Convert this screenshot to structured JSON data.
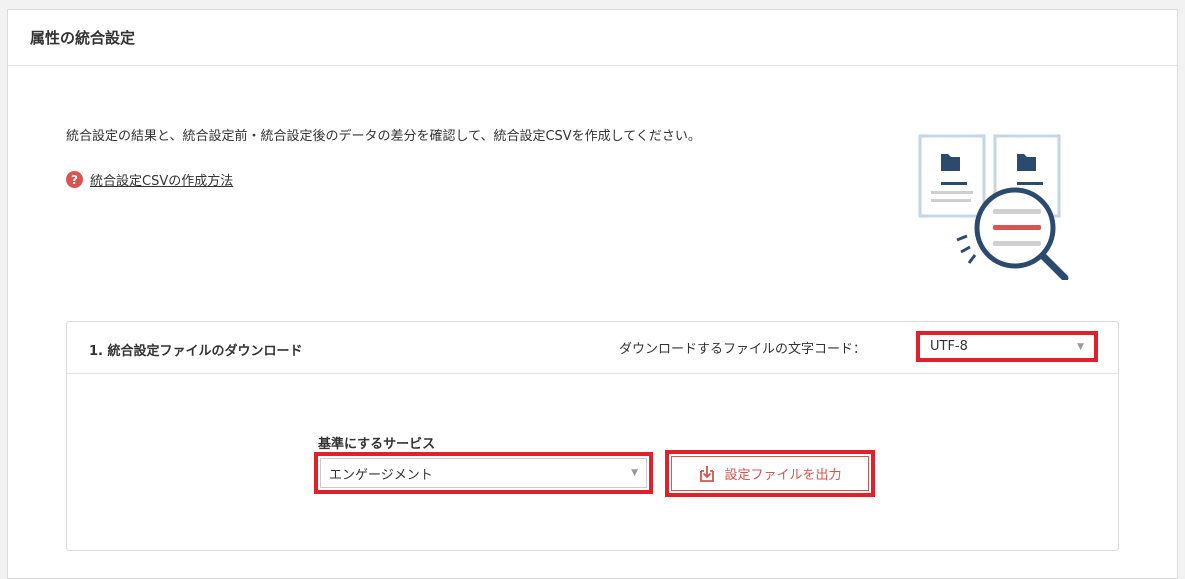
{
  "panel": {
    "title": "属性の統合設定"
  },
  "intro": {
    "text": "統合設定の結果と、統合設定前・統合設定後のデータの差分を確認して、統合設定CSVを作成してください。",
    "help_icon": "?",
    "help_link": "統合設定CSVの作成方法"
  },
  "section": {
    "title": "1. 統合設定ファイルのダウンロード",
    "encoding_label": "ダウンロードするファイルの文字コード：",
    "encoding_value": "UTF-8",
    "service_label": "基準にするサービス",
    "service_value": "エンゲージメント",
    "export_label": "設定ファイルを出力"
  },
  "icons": {
    "help": "question-circle-icon",
    "illustration": "document-compare-magnifier-illustration",
    "caret": "caret-down-icon",
    "export": "download-tray-icon"
  },
  "colors": {
    "highlight": "#e0202a",
    "accent": "#d9534f",
    "navy": "#2c4a6e",
    "paper_border": "#c4d6e2"
  }
}
